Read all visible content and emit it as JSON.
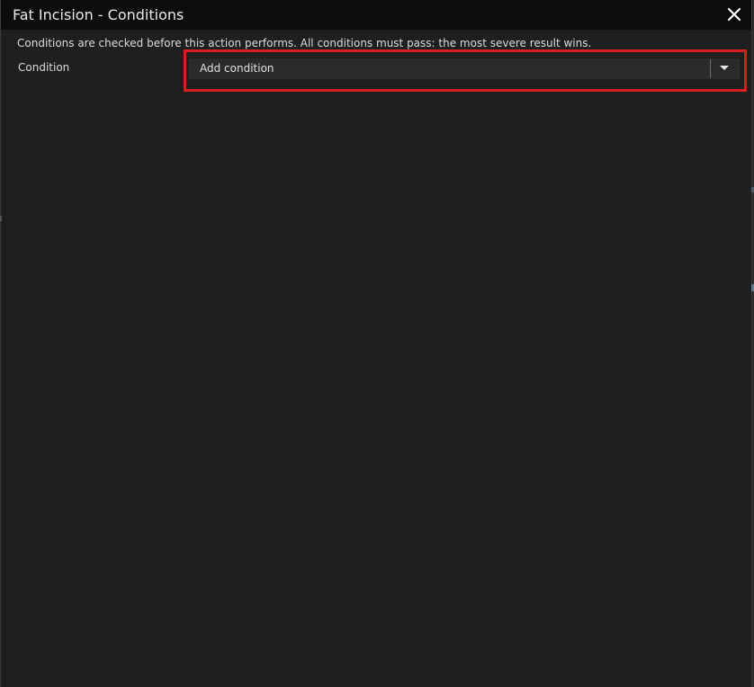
{
  "window": {
    "title": "Fat Incision - Conditions"
  },
  "description": "Conditions are checked before this action performs. All conditions must pass: the most severe result wins.",
  "condition_row": {
    "label": "Condition",
    "dropdown_value": "Add condition"
  },
  "colors": {
    "background": "#1f1f1f",
    "titlebar": "#0c0c0c",
    "dropdown": "#2b2b2b",
    "highlight": "#d81e1e"
  },
  "icons": {
    "close": "close-icon",
    "dropdown_arrow": "chevron-down-icon"
  }
}
